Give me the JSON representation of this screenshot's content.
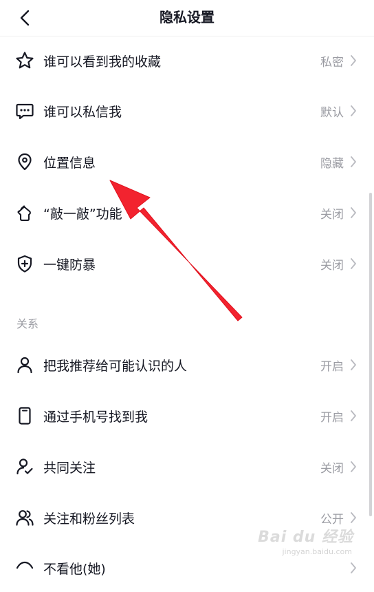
{
  "header": {
    "title": "隐私设置"
  },
  "items": [
    {
      "label": "谁可以看到我的收藏",
      "value": "私密",
      "icon": "star-icon"
    },
    {
      "label": "谁可以私信我",
      "value": "默认",
      "icon": "message-icon"
    },
    {
      "label": "位置信息",
      "value": "隐藏",
      "icon": "location-pin-icon"
    },
    {
      "label": "“敲一敲”功能",
      "value": "关闭",
      "icon": "knock-hand-icon"
    },
    {
      "label": "一键防暴",
      "value": "关闭",
      "icon": "shield-plus-icon"
    }
  ],
  "relations_section": {
    "title": "关系",
    "items": [
      {
        "label": "把我推荐给可能认识的人",
        "value": "开启",
        "icon": "user-icon"
      },
      {
        "label": "通过手机号找到我",
        "value": "开启",
        "icon": "phone-icon"
      },
      {
        "label": "共同关注",
        "value": "关闭",
        "icon": "user-check-icon"
      },
      {
        "label": "关注和粉丝列表",
        "value": "公开",
        "icon": "users-icon"
      },
      {
        "label": "不看他(她)",
        "value": "",
        "icon": "eye-off-icon"
      }
    ]
  },
  "watermark": {
    "text": "Bai du 经验",
    "sub": "jingyan.baidu.com"
  },
  "colors": {
    "text": "#161823",
    "secondary": "#9b9ca3",
    "arrow": "#f2232f"
  }
}
